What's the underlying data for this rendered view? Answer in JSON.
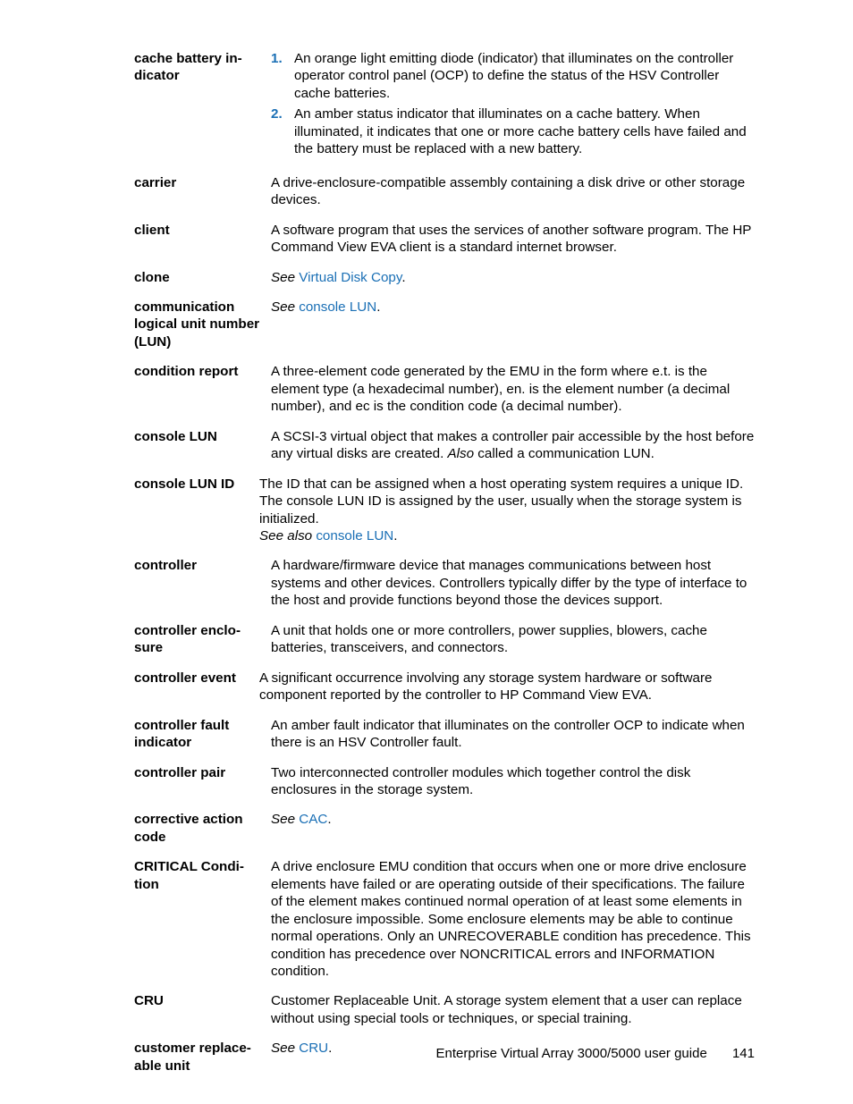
{
  "entries": [
    {
      "term": "cache battery in­dicator",
      "type": "list",
      "items": [
        {
          "num": "1.",
          "text": "An orange light emitting diode (indicator) that illuminates on the controller operator control panel (OCP) to define the status of the HSV Controller cache batteries."
        },
        {
          "num": "2.",
          "text": "An amber status indicator that illuminates on a cache battery. When illuminated, it indicates that one or more cache battery cells have failed and the battery must be replaced with a new battery."
        }
      ]
    },
    {
      "term": "carrier",
      "type": "text",
      "text": "A drive-enclosure-compatible assembly containing a disk drive or other storage devices."
    },
    {
      "term": "client",
      "type": "text",
      "text": "A software program that uses the services of another software program. The HP Command View EVA client is a standard internet browser."
    },
    {
      "term": "clone",
      "type": "see",
      "see_prefix": "See ",
      "see_link": "Virtual Disk Copy",
      "see_suffix": "."
    },
    {
      "term": "communication logical unit num­ber (LUN)",
      "type": "see",
      "see_prefix": "See ",
      "see_link": "console LUN",
      "see_suffix": "."
    },
    {
      "term": "condition report",
      "type": "text",
      "text": "A three-element code generated by the EMU in the form where e.t. is the element type (a hexadecimal number), en. is the element number (a decimal number), and ec is the condition code (a decimal number)."
    },
    {
      "term": "console LUN",
      "type": "text_also",
      "text_pre": "A SCSI-3 virtual object that makes a controller pair accessible by the host before any virtual disks are created. ",
      "also_label": "Also",
      "text_post": " called a communication LUN."
    },
    {
      "term": "console LUN ID",
      "type": "text_seealso",
      "wide": true,
      "text": "The ID that can be assigned when a host operating system requires a unique ID. The console LUN ID is assigned by the user, usually when the storage system is initialized.",
      "seealso_prefix": "See also ",
      "seealso_link": "console LUN",
      "seealso_suffix": "."
    },
    {
      "term": "controller",
      "type": "text",
      "text": "A hardware/firmware device that manages communications between host systems and other devices. Controllers typically differ by the type of interface to the host and provide functions beyond those the devices support."
    },
    {
      "term": "controller enclo­sure",
      "type": "text",
      "text": "A unit that holds one or more controllers, power supplies, blowers, cache batteries, transceivers, and connectors."
    },
    {
      "term": "controller event",
      "type": "text",
      "wide": true,
      "text": "A significant occurrence involving any storage system hardware or software component reported by the controller to HP Command View EVA."
    },
    {
      "term": "controller fault indicator",
      "type": "text",
      "text": "An amber fault indicator that illuminates on the controller OCP to indicate when there is an HSV Controller fault."
    },
    {
      "term": "controller pair",
      "type": "text",
      "text": "Two interconnected controller modules which together control the disk enclosures in the storage system."
    },
    {
      "term": "corrective action code",
      "type": "see",
      "see_prefix": "See ",
      "see_link": "CAC",
      "see_suffix": "."
    },
    {
      "term": "CRITICAL Condi­tion",
      "type": "text",
      "text": "A drive enclosure EMU condition that occurs when one or more drive enclosure elements have failed or are operating outside of their specifications. The failure of the element makes continued normal operation of at least some elements in the enclosure impossible. Some enclosure elements may be able to continue normal operations. Only an UNRECOVERABLE condition has precedence. This condition has precedence over NONCRITICAL errors and INFORMATION condition."
    },
    {
      "term": "CRU",
      "type": "text",
      "text": "Customer Replaceable Unit. A storage system element that a user can replace without using special tools or techniques, or special training."
    },
    {
      "term": "customer replace­able unit",
      "type": "see",
      "see_prefix": "See ",
      "see_link": "CRU",
      "see_suffix": "."
    }
  ],
  "footer": {
    "title": "Enterprise Virtual Array 3000/5000 user guide",
    "page": "141"
  }
}
